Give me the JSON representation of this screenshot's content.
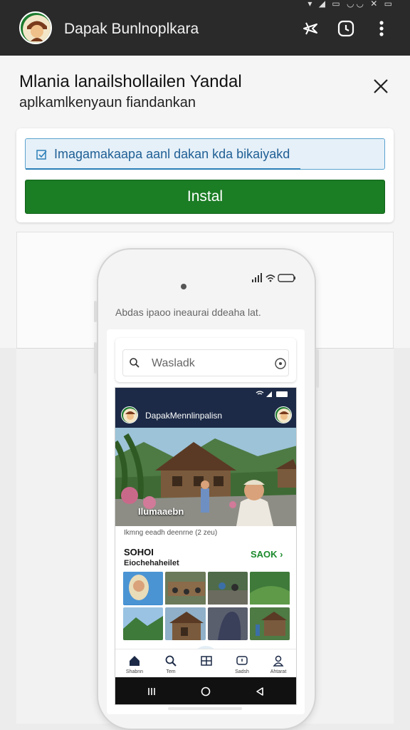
{
  "statusbar": {
    "icons": "▾ ◢ ▭ ◡◡ ✕ ▭"
  },
  "appbar": {
    "title": "Dapak Bunlnoplkara",
    "actions": [
      "airplane-icon",
      "history-icon",
      "more-vert-icon"
    ]
  },
  "prompt": {
    "title": "Mlania lanailshollailen Yandal",
    "subtitle": "aplkamlkenyaun fiandankan"
  },
  "notice": {
    "text": "Imagamakaapa aanl dakan kda bikaiyakd"
  },
  "install": {
    "label": "Instal"
  },
  "phone": {
    "caption": "Abdas ipaoo ineaurai ddeaha lat.",
    "search_placeholder": "Wasladk",
    "app_title": "DapakMennlinpalisn",
    "hero_label": "Ilumaaebn",
    "hero_caption": "Ikmng eeadh deenrne (2 zeu)",
    "section_title": "SOHOI",
    "section_subtitle": "Eiochehaheilet",
    "section_link": "SAOK ›",
    "tabs": [
      {
        "label": "Shabnn",
        "icon": "home-icon"
      },
      {
        "label": "Tem",
        "icon": "search-icon"
      },
      {
        "label": "",
        "icon": "grid-icon"
      },
      {
        "label": "Sadsh",
        "icon": "chat-icon"
      },
      {
        "label": "Ahtarat",
        "icon": "profile-icon"
      }
    ]
  },
  "colors": {
    "appbar": "#2a2a2a",
    "install": "#1b7d24",
    "notice_bg": "#e6f0f8",
    "notice_text": "#1f5f95",
    "inner_header": "#1c2a47",
    "link_green": "#1b8a2c"
  }
}
